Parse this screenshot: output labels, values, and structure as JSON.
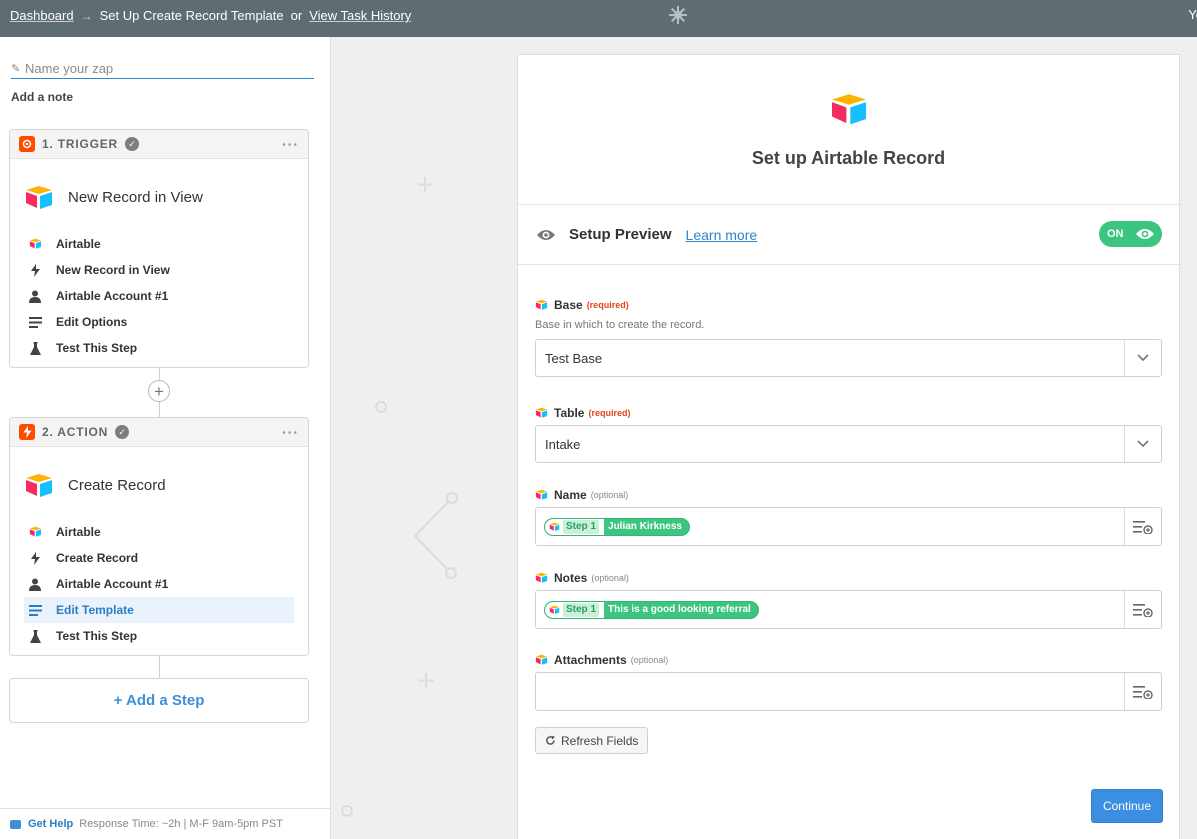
{
  "topbar": {
    "dashboard": "Dashboard",
    "arrow": "→",
    "current": "Set Up Create Record Template",
    "or": "or",
    "history": "View Task History",
    "user": "Yo"
  },
  "sidebar": {
    "zap_name_placeholder": "Name your zap",
    "add_note": "Add a note",
    "trigger": {
      "step_label": "1. TRIGGER",
      "title": "New Record in View",
      "items": [
        {
          "label": "Airtable",
          "icon": "airtable-icon"
        },
        {
          "label": "New Record in View",
          "icon": "bolt-icon"
        },
        {
          "label": "Airtable Account #1",
          "icon": "user-icon"
        },
        {
          "label": "Edit Options",
          "icon": "list-icon"
        },
        {
          "label": "Test This Step",
          "icon": "flask-icon"
        }
      ]
    },
    "action": {
      "step_label": "2. ACTION",
      "title": "Create Record",
      "items": [
        {
          "label": "Airtable",
          "icon": "airtable-icon"
        },
        {
          "label": "Create Record",
          "icon": "bolt-icon"
        },
        {
          "label": "Airtable Account #1",
          "icon": "user-icon"
        },
        {
          "label": "Edit Template",
          "icon": "list-icon",
          "active": true
        },
        {
          "label": "Test This Step",
          "icon": "flask-icon"
        }
      ]
    },
    "add_step": "+ Add a Step",
    "help": {
      "label": "Get Help",
      "response": "Response Time: ~2h | M-F 9am-5pm PST"
    }
  },
  "panel": {
    "title": "Set up Airtable Record",
    "preview_label": "Setup Preview",
    "learn_more": "Learn more",
    "toggle": "ON",
    "fields": {
      "base": {
        "label": "Base",
        "tag": "(required)",
        "help": "Base in which to create the record.",
        "value": "Test Base"
      },
      "table": {
        "label": "Table",
        "tag": "(required)",
        "value": "Intake"
      },
      "name": {
        "label": "Name",
        "tag": "(optional)",
        "token_step": "Step 1",
        "token_value": "Julian Kirkness"
      },
      "notes": {
        "label": "Notes",
        "tag": "(optional)",
        "token_step": "Step 1",
        "token_value": "This is a good looking referral"
      },
      "attachments": {
        "label": "Attachments",
        "tag": "(optional)"
      }
    },
    "refresh": "Refresh Fields",
    "continue": "Continue"
  },
  "colors": {
    "topbar": "#5f6c72",
    "accent_blue": "#3c8fe0",
    "token_green": "#3bc57f",
    "zapier_orange": "#ff4a00",
    "required_red": "#e2461b"
  }
}
